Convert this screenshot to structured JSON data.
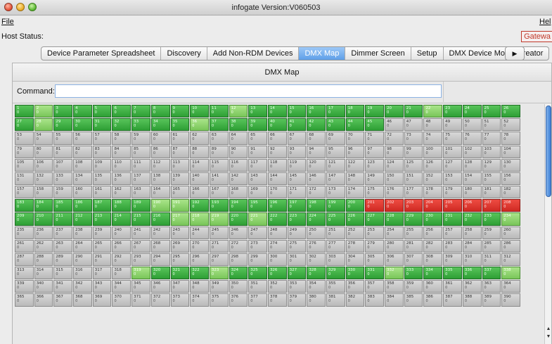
{
  "window": {
    "title": "infogate Version:V060503"
  },
  "menu": {
    "file": "File",
    "help": "Hel"
  },
  "host_status": {
    "label": "Host Status:",
    "gateway": "Gatewa"
  },
  "tabs": [
    {
      "label": "Device Parameter Spreadsheet",
      "active": false
    },
    {
      "label": "Discovery",
      "active": false
    },
    {
      "label": "Add Non-RDM Devices",
      "active": false
    },
    {
      "label": "DMX Map",
      "active": true
    },
    {
      "label": "Dimmer Screen",
      "active": false
    },
    {
      "label": "Setup",
      "active": false
    },
    {
      "label": "DMX Device Model Creator",
      "active": false
    }
  ],
  "tab_more_icon": "right-triangle-icon",
  "panel": {
    "title": "DMX Map",
    "command_label": "Command:",
    "command_value": ""
  },
  "dmx_map": {
    "value_text": "0",
    "start_channel": 1,
    "channel_count": 390,
    "state_legend": {
      "g": "#2e9f35",
      "lg": "#79c659",
      "r": "#cf2a23",
      "gray": "#b9b9b9"
    },
    "states": {
      "1": "g",
      "2": "lg",
      "3": "g",
      "4": "g",
      "5": "g",
      "6": "g",
      "7": "g",
      "8": "g",
      "9": "g",
      "10": "g",
      "11": "g",
      "12": "lg",
      "13": "g",
      "14": "g",
      "15": "g",
      "16": "g",
      "17": "g",
      "18": "g",
      "19": "g",
      "20": "g",
      "21": "g",
      "22": "lg",
      "23": "g",
      "24": "g",
      "25": "g",
      "26": "g",
      "27": "g",
      "28": "lg",
      "29": "g",
      "30": "g",
      "31": "g",
      "32": "g",
      "33": "g",
      "34": "g",
      "35": "g",
      "36": "lg",
      "37": "g",
      "38": "g",
      "39": "g",
      "40": "g",
      "41": "g",
      "42": "g",
      "43": "g",
      "44": "g",
      "45": "g",
      "191": "lg",
      "192": "g",
      "183": "g",
      "184": "g",
      "185": "g",
      "186": "g",
      "187": "g",
      "188": "g",
      "189": "g",
      "190": "lg",
      "193": "g",
      "194": "g",
      "195": "g",
      "196": "g",
      "197": "g",
      "198": "g",
      "199": "g",
      "200": "g",
      "201": "r",
      "202": "r",
      "203": "r",
      "204": "r",
      "205": "r",
      "206": "r",
      "207": "r",
      "208": "r",
      "209": "g",
      "210": "g",
      "211": "g",
      "212": "g",
      "213": "g",
      "214": "g",
      "215": "g",
      "216": "g",
      "217": "lg",
      "218": "lg",
      "219": "lg",
      "220": "g",
      "221": "lg",
      "222": "g",
      "223": "g",
      "224": "g",
      "225": "g",
      "226": "g",
      "227": "g",
      "228": "g",
      "229": "g",
      "230": "g",
      "231": "g",
      "232": "g",
      "233": "g",
      "234": "lg",
      "319": "lg",
      "320": "g",
      "321": "g",
      "322": "g",
      "323": "lg",
      "324": "g",
      "325": "g",
      "326": "g",
      "327": "g",
      "328": "g",
      "329": "g",
      "330": "g",
      "331": "g",
      "332": "lg",
      "333": "g",
      "334": "g",
      "335": "g",
      "336": "g",
      "337": "g",
      "338": "lg"
    }
  }
}
